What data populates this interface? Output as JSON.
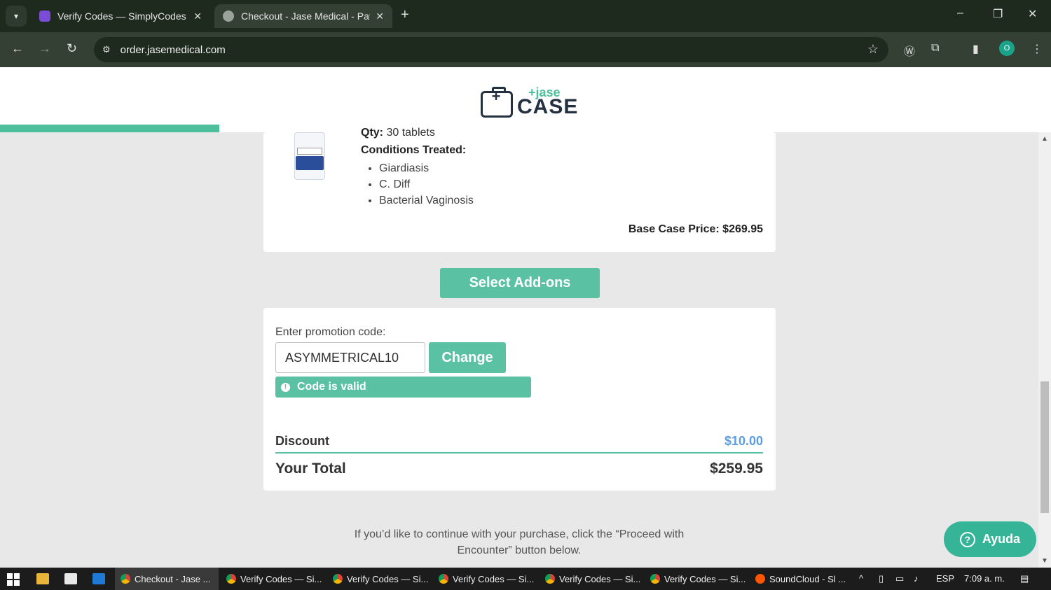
{
  "browser": {
    "tabs": [
      {
        "title": "Verify Codes — SimplyCodes",
        "close": "✕"
      },
      {
        "title": "Checkout - Jase Medical - Patie",
        "close": "✕"
      }
    ],
    "new_tab": "+",
    "url": "order.jasemedical.com",
    "window": {
      "minimize": "–",
      "restore": "❐",
      "close": "✕"
    },
    "nav": {
      "back": "←",
      "forward": "→",
      "reload": "↻"
    },
    "profile_initial": "O"
  },
  "brand": {
    "jase": "+jase",
    "case": "CASE"
  },
  "product": {
    "qty_label": "Qty:",
    "qty_value": "30 tablets",
    "conditions_title": "Conditions Treated:",
    "conditions": [
      "Giardiasis",
      "C. Diff",
      "Bacterial Vaginosis"
    ],
    "base_price": "Base Case Price: $269.95"
  },
  "addons_button": "Select Add-ons",
  "promo": {
    "label": "Enter promotion code:",
    "value": "ASYMMETRICAL10",
    "change_button": "Change",
    "status": "Code is valid"
  },
  "summary": {
    "discount_label": "Discount",
    "discount_value": "$10.00",
    "total_label": "Your Total",
    "total_value": "$259.95"
  },
  "proceed_text": "If you’d like to continue with your purchase, click the “Proceed with Encounter” button below.",
  "help_button": "Ayuda",
  "colors": {
    "accent": "#5bc1a3",
    "brand_dark": "#233040",
    "discount": "#5b9ee0"
  },
  "taskbar": {
    "items": [
      {
        "label": "Checkout - Jase ...",
        "icon": "chrome-icon"
      },
      {
        "label": "Verify Codes — Si...",
        "icon": "chrome-icon"
      },
      {
        "label": "Verify Codes — Si...",
        "icon": "chrome-icon"
      },
      {
        "label": "Verify Codes — Si...",
        "icon": "chrome-icon"
      },
      {
        "label": "Verify Codes — Si...",
        "icon": "chrome-icon"
      },
      {
        "label": "Verify Codes — Si...",
        "icon": "chrome-icon"
      },
      {
        "label": "SoundCloud - Sl ...",
        "icon": "soundcloud-icon"
      }
    ],
    "language": "ESP",
    "time": "7:09 a. m."
  }
}
